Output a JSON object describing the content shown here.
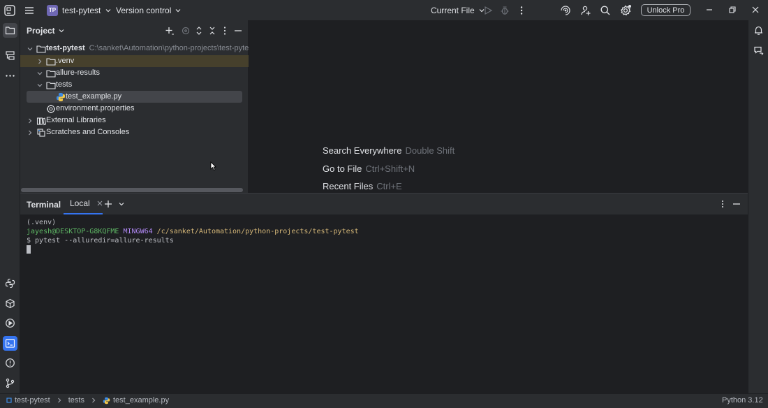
{
  "titlebar": {
    "project_badge": "TP",
    "project_name": "test-pytest",
    "version_control": "Version control",
    "run_config": "Current File",
    "unlock_label": "Unlock Pro"
  },
  "project_panel": {
    "title": "Project",
    "tree": [
      {
        "label": "test-pytest",
        "path": "C:\\sanket\\Automation\\python-projects\\test-pytest"
      },
      {
        "label": ".venv"
      },
      {
        "label": "allure-results"
      },
      {
        "label": "tests"
      },
      {
        "label": "test_example.py"
      },
      {
        "label": "environment.properties"
      },
      {
        "label": "External Libraries"
      },
      {
        "label": "Scratches and Consoles"
      }
    ]
  },
  "editor": {
    "hints": [
      {
        "action": "Search Everywhere",
        "shortcut": "Double Shift"
      },
      {
        "action": "Go to File",
        "shortcut": "Ctrl+Shift+N"
      },
      {
        "action": "Recent Files",
        "shortcut": "Ctrl+E"
      }
    ]
  },
  "terminal": {
    "title": "Terminal",
    "tab": "Local",
    "lines": {
      "venv": "(.venv)",
      "user": "jayesh@DESKTOP-G8KQFME",
      "host": "MINGW64",
      "path": "/c/sanket/Automation/python-projects/test-pytest",
      "command": "$ pytest --alluredir=allure-results"
    }
  },
  "statusbar": {
    "breadcrumb": [
      "test-pytest",
      "tests",
      "test_example.py"
    ],
    "interpreter": "Python 3.12"
  },
  "colors": {
    "accent": "#3574f0",
    "panel_bg": "#2b2d30",
    "editor_bg": "#1e1f22",
    "highlight_row": "#46402c"
  }
}
